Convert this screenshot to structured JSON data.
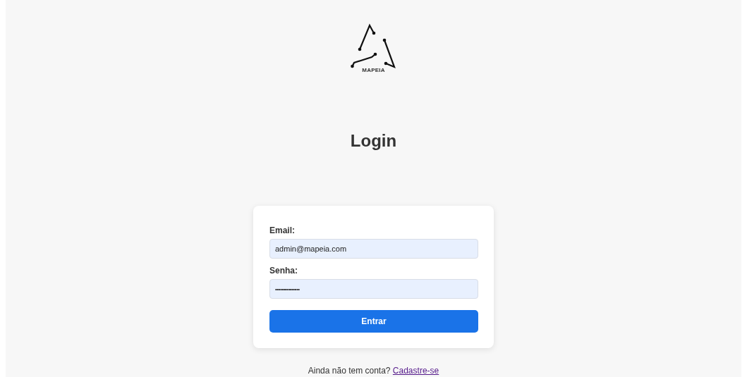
{
  "logo": {
    "text": "MAPEIA"
  },
  "title": "Login",
  "form": {
    "fields": [
      {
        "label": "Email:",
        "value": "admin@mapeia.com",
        "kind": "text"
      },
      {
        "label": "Senha:",
        "value": "•••••••••••••••",
        "kind": "password"
      }
    ],
    "submit": "Entrar"
  },
  "footer": {
    "text": "Ainda não tem conta?",
    "link": "Cadastre-se"
  }
}
